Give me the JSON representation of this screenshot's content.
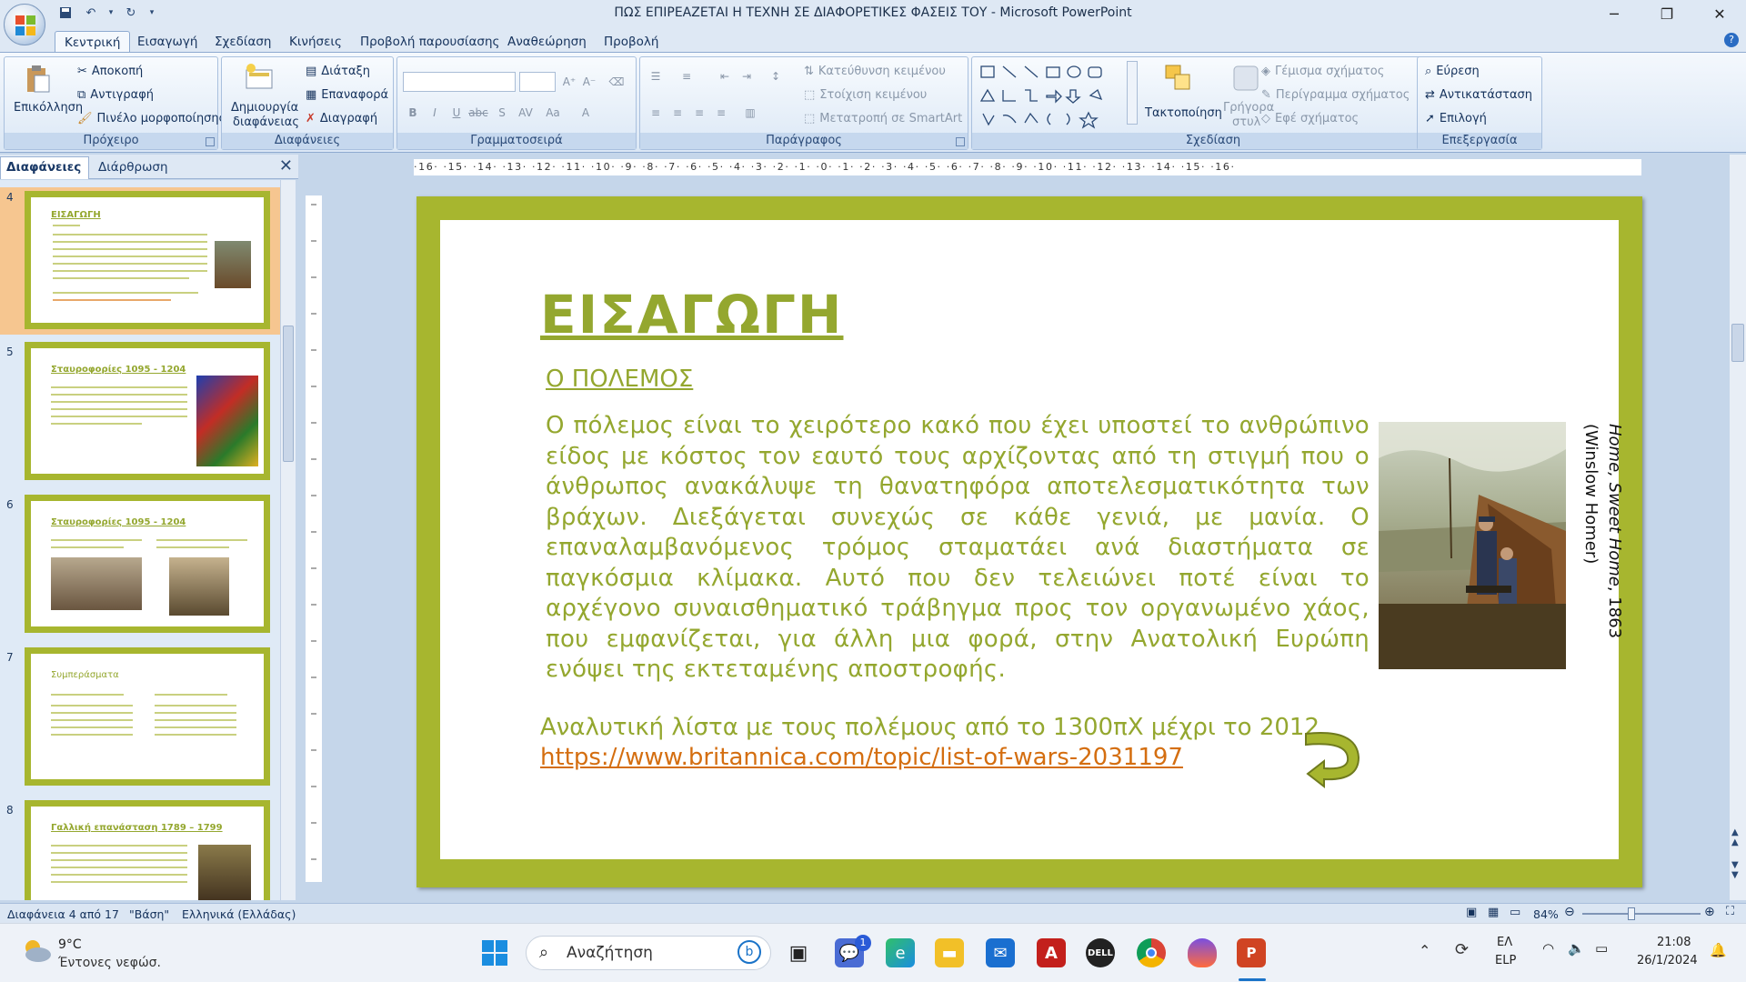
{
  "window": {
    "title": "ΠΩΣ ΕΠΙΡΕΑΖΕΤΑΙ Η ΤΕΧΝΗ ΣΕ ΔΙΑΦΟΡΕΤΙΚΕΣ ΦΑΣΕΙΣ ΤΟΥ - Microsoft PowerPoint"
  },
  "tabs": [
    "Κεντρική",
    "Εισαγωγή",
    "Σχεδίαση",
    "Κινήσεις",
    "Προβολή παρουσίασης",
    "Αναθεώρηση",
    "Προβολή"
  ],
  "ribbon": {
    "clipboard": {
      "label": "Πρόχειρο",
      "paste": "Επικόλληση",
      "cut": "Αποκοπή",
      "copy": "Αντιγραφή",
      "format_painter": "Πινέλο μορφοποίησης"
    },
    "slides": {
      "label": "Διαφάνειες",
      "new_slide_1": "Δημιουργία",
      "new_slide_2": "διαφάνειας",
      "layout": "Διάταξη",
      "reset": "Επαναφορά",
      "delete": "Διαγραφή"
    },
    "font": {
      "label": "Γραμματοσειρά"
    },
    "paragraph": {
      "label": "Παράγραφος",
      "text_direction": "Κατεύθυνση κειμένου",
      "align_text": "Στοίχιση κειμένου",
      "smartart": "Μετατροπή σε SmartArt"
    },
    "drawing": {
      "label": "Σχεδίαση",
      "arrange": "Τακτοποίηση",
      "quick_styles_1": "Γρήγορα",
      "quick_styles_2": "στυλ",
      "shape_fill": "Γέμισμα σχήματος",
      "shape_outline": "Περίγραμμα σχήματος",
      "shape_effects": "Εφέ σχήματος"
    },
    "editing": {
      "label": "Επεξεργασία",
      "find": "Εύρεση",
      "replace": "Αντικατάσταση",
      "select": "Επιλογή"
    }
  },
  "pane": {
    "tab_slides": "Διαφάνειες",
    "tab_outline": "Διάρθρωση"
  },
  "thumbnails": [
    {
      "num": "4",
      "title": "ΕΙΣΑΓΩΓΗ",
      "selected": true
    },
    {
      "num": "5",
      "title": "Σταυροφορίες 1095 - 1204",
      "selected": false
    },
    {
      "num": "6",
      "title": "Σταυροφορίες 1095 - 1204",
      "selected": false
    },
    {
      "num": "7",
      "title": "Συμπεράσματα",
      "selected": false
    },
    {
      "num": "8",
      "title": "Γαλλική επανάσταση 1789 – 1799",
      "selected": false
    }
  ],
  "ruler": {
    "h": "·16· ·15· ·14· ·13· ·12· ·11· ·10· ·9· ·8· ·7· ·6· ·5· ·4· ·3· ·2· ·1· ·0· ·1· ·2· ·3· ·4· ·5· ·6· ·7· ·8· ·9· ·10· ·11· ·12· ·13· ·14· ·15· ·16·"
  },
  "slide": {
    "title": "ΕΙΣΑΓΩΓΗ",
    "subtitle": "Ο ΠΟΛΕΜΟΣ",
    "body": "Ο πόλεμος είναι το χειρότερο κακό που έχει  υποστεί το ανθρώπινο είδος με κόστος τον εαυτό τους αρχίζοντας από τη στιγμή  που ο άνθρωπος ανακάλυψε τη θανατηφόρα αποτελεσματικότητα των βράχων. Διεξάγεται συνεχώς σε κάθε γενιά, με μανία. Ο επαναλαμβανόμενος τρόμος σταματάει ανά διαστήματα σε παγκόσμια κλίμακα. Αυτό που δεν τελειώνει ποτέ είναι το αρχέγονο συναισθηματικό τράβηγμα προς τον οργανωμένο χάος, που εμφανίζεται, για άλλη μια φορά, στην Ανατολική Ευρώπη ενόψει της εκτεταμένης αποστροφής.",
    "list_text": "Αναλυτική λίστα με τους πολέμους από το 1300πΧ μέχρι το 2012",
    "link": "https://www.britannica.com/topic/list-of-wars-2031197",
    "caption_title": "Home, Sweet Home",
    "caption_year": ", 1863",
    "caption_artist": "(Winslow Homer)"
  },
  "status": {
    "slide": "Διαφάνεια 4 από 17",
    "theme": "\"Βάση\"",
    "language": "Ελληνικά (Ελλάδας)",
    "zoom": "84%"
  },
  "taskbar": {
    "weather_temp": "9°C",
    "weather_desc": "Έντονες νεφώσ.",
    "search": "Αναζήτηση",
    "lang1": "ΕΛ",
    "lang2": "ELP",
    "time": "21:08",
    "date": "26/1/2024",
    "badge": "1"
  },
  "colors": {
    "slide_green": "#a7b62f",
    "text_green": "#94a72f",
    "link": "#d46e10"
  }
}
